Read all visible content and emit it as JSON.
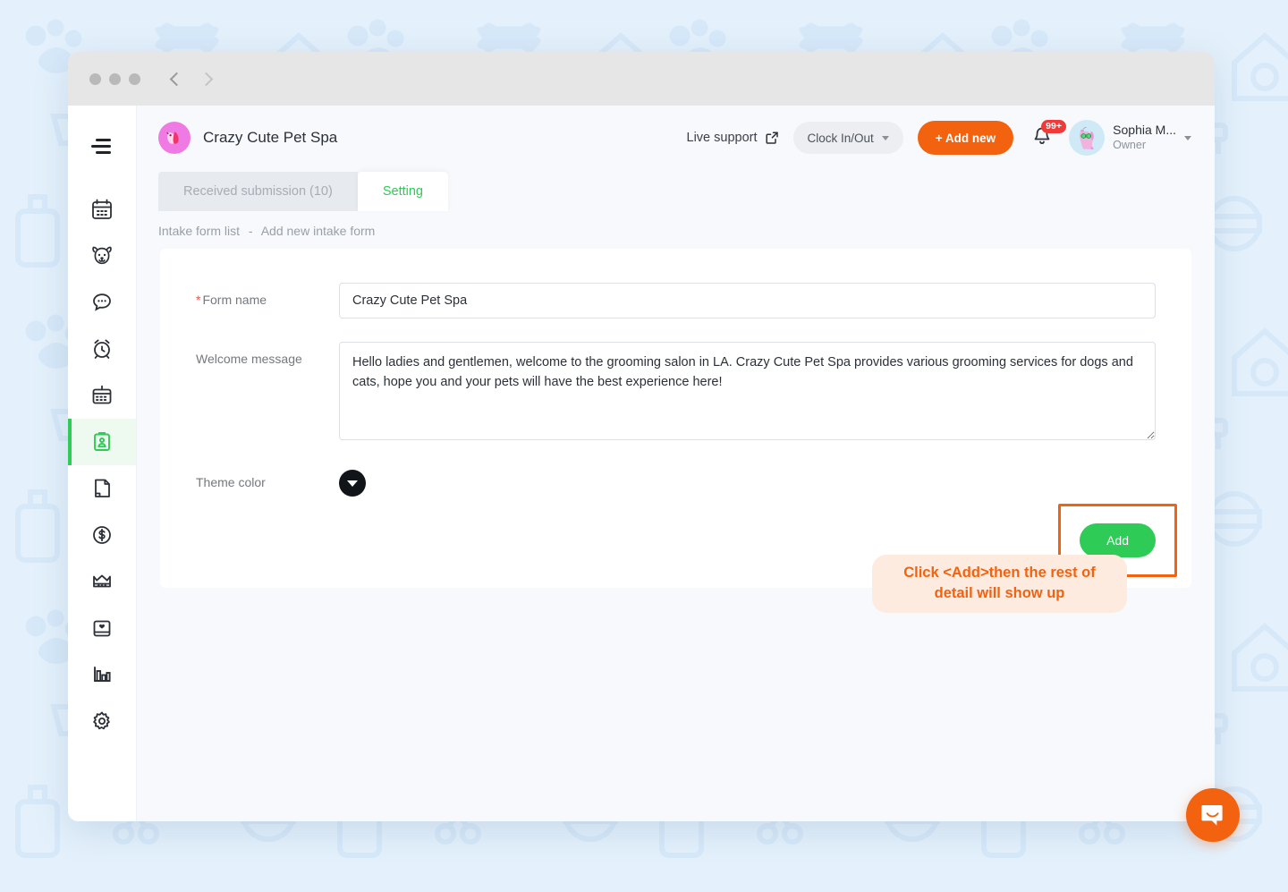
{
  "window": {
    "traffic_lights": [
      "close",
      "minimize",
      "maximize"
    ],
    "back_label": "Back",
    "forward_label": "Forward"
  },
  "sidebar": {
    "items": [
      {
        "label": "Menu",
        "icon": "hamburger-icon",
        "active": false
      },
      {
        "label": "Calendar",
        "icon": "calendar-icon",
        "active": false
      },
      {
        "label": "Pets",
        "icon": "dog-face-icon",
        "active": false
      },
      {
        "label": "Messages",
        "icon": "chat-bubble-icon",
        "active": false
      },
      {
        "label": "Time clock",
        "icon": "alarm-clock-icon",
        "active": false
      },
      {
        "label": "Schedule",
        "icon": "calendar-grid-icon",
        "active": false
      },
      {
        "label": "Intake forms",
        "icon": "clipboard-person-icon",
        "active": true
      },
      {
        "label": "Notes",
        "icon": "note-page-icon",
        "active": false
      },
      {
        "label": "Payments",
        "icon": "dollar-circle-icon",
        "active": false
      },
      {
        "label": "Memberships",
        "icon": "crown-icon",
        "active": false
      },
      {
        "label": "Gift cards",
        "icon": "gift-card-heart-icon",
        "active": false
      },
      {
        "label": "Reports",
        "icon": "bar-chart-icon",
        "active": false
      },
      {
        "label": "Settings",
        "icon": "gear-icon",
        "active": false
      }
    ]
  },
  "header": {
    "brand_name": "Crazy Cute Pet Spa",
    "brand_logo_icon": "pet-spa-logo",
    "live_support_label": "Live support",
    "live_support_icon": "external-link-icon",
    "clock_button_label": "Clock In/Out",
    "clock_button_caret_icon": "chevron-down-icon",
    "add_new_label": "+ Add new",
    "bell_icon": "notification-bell-icon",
    "bell_badge": "99+",
    "avatar_icon": "user-avatar-dog",
    "user_name": "Sophia M...",
    "user_role": "Owner",
    "user_caret_icon": "chevron-down-icon"
  },
  "tabs": [
    {
      "label": "Received submission (10)",
      "active": false
    },
    {
      "label": "Setting",
      "active": true
    }
  ],
  "breadcrumb": {
    "parent": "Intake form list",
    "separator": "-",
    "current": "Add new intake form"
  },
  "form": {
    "form_name": {
      "label": "Form name",
      "required_marker": "*",
      "value": "Crazy Cute Pet Spa",
      "placeholder": "Form name"
    },
    "welcome_message": {
      "label": "Welcome message",
      "value": "Hello ladies and gentlemen, welcome to the grooming salon in LA. Crazy Cute Pet Spa provides various grooming services for dogs and cats, hope you and your pets will have the best experience here!",
      "placeholder": "Welcome message"
    },
    "theme_color": {
      "label": "Theme color",
      "value": "#111418",
      "caret_icon": "chevron-down-icon"
    },
    "submit_label": "Add"
  },
  "callout": {
    "text": "Click <Add>then the rest of detail will show up",
    "line1": "Click <Add>then the rest of",
    "line2": "detail will show up",
    "text_color": "#f2620f",
    "background": "#fdebe0"
  },
  "highlight": {
    "color": "#f2620f"
  },
  "intercom": {
    "label": "Open chat",
    "icon": "intercom-chat-icon",
    "color": "#f2620f"
  },
  "colors": {
    "accent_green": "#2ecb57",
    "accent_orange": "#f2620f",
    "page_background": "#e4f1fc",
    "brand_pink": "#ef7ae4",
    "badge_red": "#f03a3a"
  }
}
